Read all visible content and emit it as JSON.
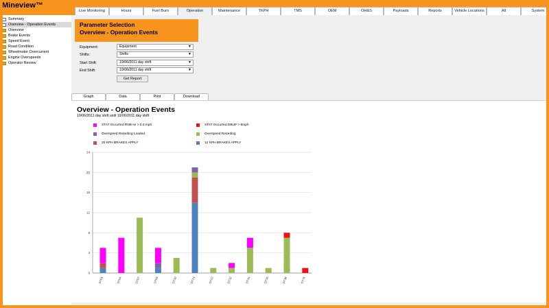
{
  "app": {
    "title": "Mineview™"
  },
  "nav_tabs": [
    {
      "label": "Live Monitoring",
      "active": false
    },
    {
      "label": "Hours",
      "active": false
    },
    {
      "label": "Fuel Burn",
      "active": false
    },
    {
      "label": "Operation",
      "active": true
    },
    {
      "label": "Maintenance",
      "active": false
    },
    {
      "label": "TKPH",
      "active": false
    },
    {
      "label": "TMS",
      "active": false
    },
    {
      "label": "OEM",
      "active": false
    },
    {
      "label": "OH&S",
      "active": false
    },
    {
      "label": "Payloads",
      "active": false
    },
    {
      "label": "Reports",
      "active": false
    },
    {
      "label": "Vehicle Locations",
      "active": false
    },
    {
      "label": "All",
      "active": false
    },
    {
      "label": "System",
      "active": false
    }
  ],
  "sidebar": {
    "items": [
      {
        "label": "Summary",
        "icon": "document-icon",
        "active": false
      },
      {
        "label": "Overview - Operation Events",
        "icon": "document-icon",
        "active": true
      },
      {
        "label": "Overview",
        "icon": "folder-icon",
        "active": false
      },
      {
        "label": "Brake Events",
        "icon": "folder-icon",
        "active": false
      },
      {
        "label": "Speed Event",
        "icon": "folder-icon",
        "active": false
      },
      {
        "label": "Road Condition",
        "icon": "folder-icon",
        "active": false
      },
      {
        "label": "Wheelmotor Overcurrent",
        "icon": "folder-icon",
        "active": false
      },
      {
        "label": "Engine Overspeeds",
        "icon": "folder-icon",
        "active": false
      },
      {
        "label": "Operator Review",
        "icon": "folder-icon",
        "active": false
      }
    ]
  },
  "params": {
    "title_line1": "Parameter Selection",
    "title_line2": "Overview - Operation Events",
    "equipment_label": "Equipment:",
    "equipment_value": "Equipment",
    "shifts_label": "Shifts:",
    "shifts_value": "Shifts",
    "start_label": "Start Shift:",
    "start_value": "19/06/2011 day shift",
    "end_label": "End Shift:",
    "end_value": "19/06/2011 day shift",
    "get_report": "Get Report",
    "arrow_glyph": "▼"
  },
  "view_tabs": [
    {
      "label": "Graph"
    },
    {
      "label": "Data"
    },
    {
      "label": "Print"
    },
    {
      "label": "Download"
    }
  ],
  "report": {
    "title": "Overview - Operation Events",
    "subtitle": "19/06/2011 day shift until 19/06/2011 day shift"
  },
  "colors": {
    "brand_orange": "#f7941d",
    "magenta": "#ff00ff",
    "red": "#ee1111",
    "purple": "#8064a2",
    "green": "#9bbb59",
    "darkred": "#c0504d",
    "blue": "#4f81bd"
  },
  "chart_data": {
    "type": "bar",
    "stacked": true,
    "categories": [
      "DT01",
      "DT04",
      "DT07",
      "DT09",
      "DT10",
      "DT13",
      "DT22",
      "DT32",
      "DT34",
      "DT35",
      "DT36",
      "DT76"
    ],
    "ylim": [
      0,
      24
    ],
    "yticks": [
      "0",
      "4",
      "8",
      "12",
      "16",
      "20",
      "24"
    ],
    "grid": true,
    "legend_position": "top",
    "series": [
      {
        "name": "STAT Occurred RNB se > 0.3 mph",
        "color": "#ff00ff",
        "values": [
          3,
          7,
          0,
          3,
          0,
          0,
          0,
          1,
          2,
          0,
          0,
          0
        ]
      },
      {
        "name": "STAT Occurred DBUP > 8mph",
        "color": "#ee1111",
        "values": [
          0,
          0,
          0,
          0,
          0,
          0,
          0,
          0,
          0,
          0,
          1,
          1
        ]
      },
      {
        "name": "Overspeed Retarding Loaded",
        "color": "#8064a2",
        "values": [
          0,
          0,
          0,
          1,
          0,
          1,
          0,
          0,
          0,
          0,
          0,
          0
        ]
      },
      {
        "name": "Overspeed Retarding",
        "color": "#9bbb59",
        "values": [
          0,
          0,
          11,
          0,
          3,
          1,
          1,
          1,
          5,
          1,
          7,
          0
        ]
      },
      {
        "name": "20 KPH BRAKES APPLY",
        "color": "#c0504d",
        "values": [
          1,
          0,
          0,
          0,
          0,
          5,
          0,
          0,
          0,
          0,
          0,
          0
        ]
      },
      {
        "name": "12 KPH BRAKES APPLY",
        "color": "#4f81bd",
        "values": [
          1,
          0,
          0,
          1,
          0,
          14,
          0,
          0,
          0,
          0,
          0,
          0
        ]
      }
    ]
  }
}
